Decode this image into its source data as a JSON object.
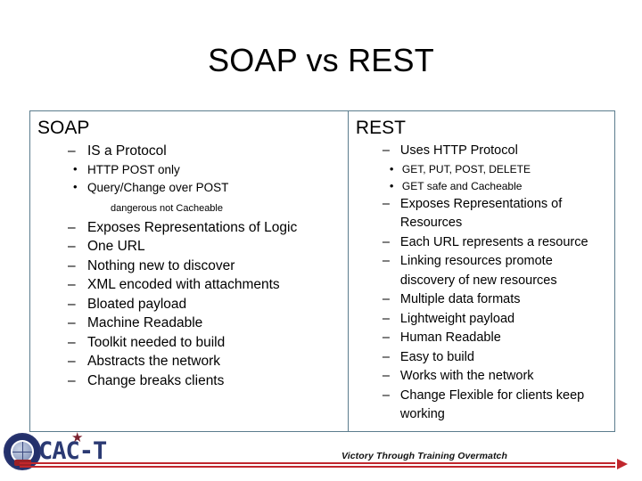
{
  "slide": {
    "title": "SOAP vs REST"
  },
  "table": {
    "soap": {
      "heading": "SOAP",
      "items": [
        {
          "text": "IS a Protocol"
        },
        {
          "text": "Exposes Representations of Logic"
        },
        {
          "text": "One URL"
        },
        {
          "text": "Nothing new to discover"
        },
        {
          "text": "XML encoded with attachments"
        },
        {
          "text": "Bloated payload"
        },
        {
          "text": "Machine Readable"
        },
        {
          "text": "Toolkit needed to build"
        },
        {
          "text": "Abstracts the network"
        },
        {
          "text": "Change breaks clients"
        }
      ],
      "sub_items": [
        {
          "text": "HTTP POST only"
        },
        {
          "text": "Query/Change over POST"
        }
      ],
      "note": "dangerous not Cacheable"
    },
    "rest": {
      "heading": "REST",
      "items": [
        {
          "text": "Uses HTTP Protocol"
        },
        {
          "text": "Exposes Representations of Resources"
        },
        {
          "text": "Each URL represents a resource"
        },
        {
          "text": "Linking resources promote discovery of new resources"
        },
        {
          "text": "Multiple data formats"
        },
        {
          "text": "Lightweight payload"
        },
        {
          "text": "Human Readable"
        },
        {
          "text": "Easy to build"
        },
        {
          "text": "Works with the network"
        },
        {
          "text": "Change Flexible for clients keep working"
        }
      ],
      "sub_items": [
        {
          "text": "GET, PUT, POST, DELETE"
        },
        {
          "text": "GET safe and Cacheable"
        }
      ]
    },
    "bullets": {
      "dash": "–",
      "dot": "•"
    },
    "border_color": "#5b7c8d"
  },
  "footer": {
    "logo_text": "CAC-T",
    "logo_star": "★",
    "tagline": "Victory Through Training Overmatch",
    "rule_color": "#c0272d",
    "logo_color": "#2b3a73"
  }
}
